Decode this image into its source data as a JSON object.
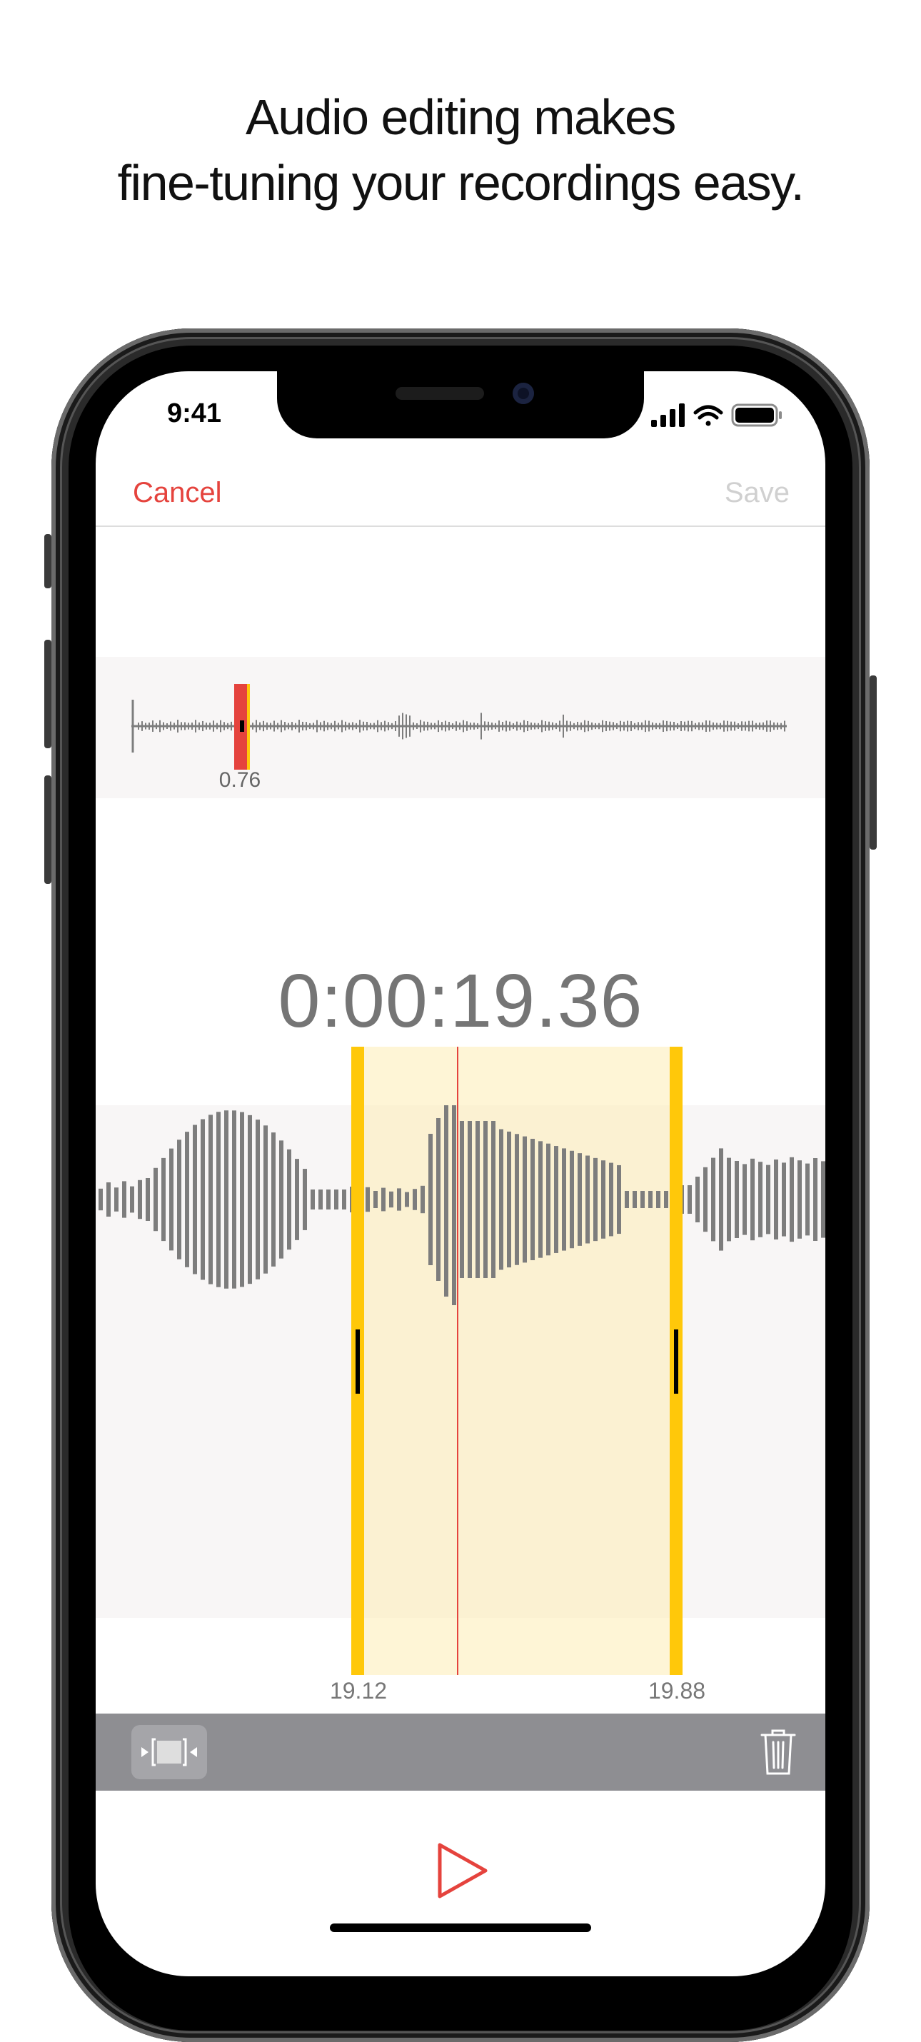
{
  "headline": {
    "line1": "Audio editing makes",
    "line2": "fine-tuning your recordings easy."
  },
  "status_bar": {
    "time": "9:41",
    "icons": [
      "cellular-signal-icon",
      "wifi-icon",
      "battery-icon"
    ]
  },
  "nav": {
    "cancel_label": "Cancel",
    "save_label": "Save"
  },
  "overview": {
    "playhead_label": "0.76"
  },
  "editor": {
    "timecode": "0:00:19.36",
    "selection_start_label": "19.12",
    "selection_end_label": "19.88"
  },
  "toolbar": {
    "icons": [
      "trim-icon",
      "trash-icon"
    ]
  },
  "player": {
    "icon": "play-icon"
  },
  "colors": {
    "accent_red": "#e5433d",
    "selection_yellow": "#ffc80a",
    "waveform_gray": "#7d7d7d",
    "toolbar_gray": "#8e8e92"
  }
}
